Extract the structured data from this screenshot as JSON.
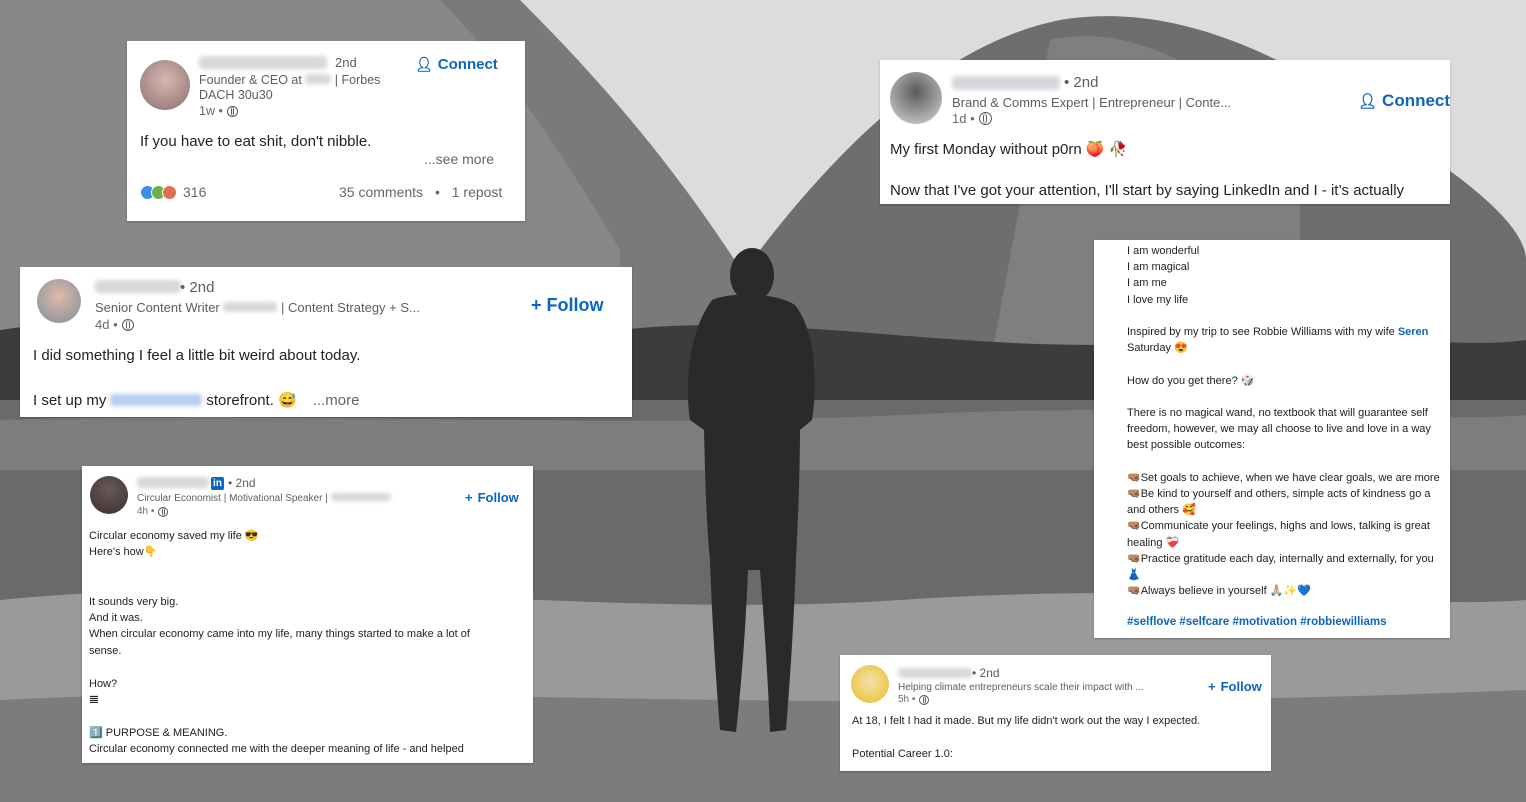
{
  "background": {
    "palette": [
      "#f2f2f2",
      "#7d7d7d",
      "#3a3a3a"
    ],
    "description_icon": "landscape"
  },
  "cards": {
    "card1": {
      "degree": "2nd",
      "subtitle_line1": "Founder & CEO at",
      "subtitle_line1b": "| Forbes",
      "subtitle_line2": "DACH 30u30",
      "meta": "1w •",
      "connect": "Connect",
      "text": "If you have to eat shit, don't nibble.",
      "see_more": "...see more",
      "reaction_count": "316",
      "comments": "35 comments",
      "dot": "•",
      "reposts": "1 repost"
    },
    "card2": {
      "degree": "• 2nd",
      "subtitle": "Brand & Comms Expert | Entrepreneur | Conte...",
      "meta": "1d •",
      "connect": "Connect",
      "line1": "My first Monday without p0rn 🍑 🥀",
      "line2": "Now that I've got your attention, I'll start by saying LinkedIn and I - it’s actually"
    },
    "card3": {
      "degree": "• 2nd",
      "subtitle_a": "Senior Content Writer",
      "subtitle_b": "| Content Strategy + S...",
      "meta": "4d •",
      "follow": "Follow",
      "line1": "I did something I feel a little bit weird about today.",
      "line2a": "I set up my",
      "line2b": "storefront. 😅",
      "more": "...more"
    },
    "card4": {
      "lines": [
        "I am wonderful",
        "I am magical",
        "I am me",
        "I love my life",
        "",
        "Inspired by my trip to see Robbie Williams with my wife",
        "Saturday 😍",
        "",
        "How do you get there? 🎲",
        "",
        "There is no magical wand, no textbook that will guarantee self",
        "freedom, however, we may all choose to live and love in a way",
        "best possible outcomes:",
        "",
        "🤜🏽Set goals to achieve, when we have clear goals, we are more",
        "🤜🏽Be kind to yourself and others, simple acts of kindness go a",
        "and others 🥰",
        "🤜🏽Communicate your feelings, highs and lows, talking is great",
        "healing ❤️‍🩹",
        "🤜🏽Practice gratitude each day, internally and externally, for you",
        "👗",
        "🤜🏽Always believe in yourself 🙏🏼✨💙"
      ],
      "mention": "Seren",
      "hashtags": "#selflove #selfcare #motivation #robbiewilliams"
    },
    "card5": {
      "in_badge": "in",
      "degree": "• 2nd",
      "subtitle": "Circular Economist | Motivational Speaker |",
      "meta": "4h •",
      "follow": "Follow",
      "lines": [
        "Circular economy saved my life 😎",
        "Here's how👇",
        "",
        "",
        "It sounds very big.",
        "And it was.",
        "When circular economy came into my life, many things started to make a lot of",
        "sense.",
        "",
        "How?",
        "𝌆",
        "",
        "1️⃣ PURPOSE & MEANING.",
        "Circular economy connected me with the deeper meaning of life - and helped"
      ]
    },
    "card6": {
      "degree": "• 2nd",
      "subtitle": "Helping climate entrepreneurs scale their impact with ...",
      "meta": "5h •",
      "follow": "Follow",
      "line1": "At 18, I felt I had it made. But my life didn't work out the way I expected.",
      "line2": "Potential Career 1.0:"
    }
  }
}
